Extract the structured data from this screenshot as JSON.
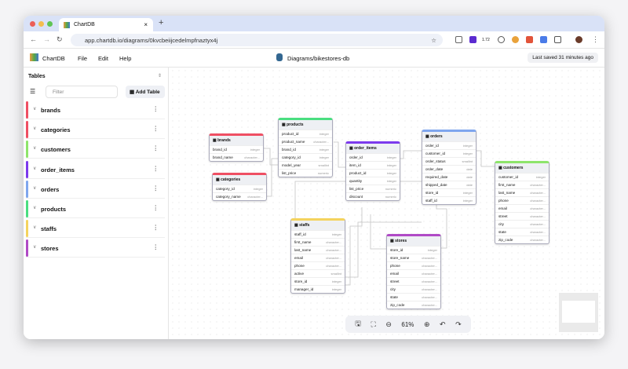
{
  "browser": {
    "tab_title": "ChartDB",
    "url": "app.chartdb.io/diagrams/0kvcbeiijcedelmpfnaztyx4j",
    "ext_badge": "1.72"
  },
  "app": {
    "logo": "ChartDB",
    "menu": [
      "File",
      "Edit",
      "Help"
    ],
    "diagram_title": "Diagrams/bikestores-db",
    "saved": "Last saved 31 minutes ago"
  },
  "sidebar": {
    "title": "Tables",
    "filter_placeholder": "Filter",
    "add_table": "Add Table",
    "items": [
      {
        "label": "brands",
        "color": "#ef4f63"
      },
      {
        "label": "categories",
        "color": "#ef4f63"
      },
      {
        "label": "customers",
        "color": "#8ee56b"
      },
      {
        "label": "order_items",
        "color": "#7c3aed"
      },
      {
        "label": "orders",
        "color": "#7fa6ee"
      },
      {
        "label": "products",
        "color": "#4ade80"
      },
      {
        "label": "staffs",
        "color": "#f4d35e"
      },
      {
        "label": "stores",
        "color": "#b04ac6"
      }
    ]
  },
  "tables": [
    {
      "name": "brands",
      "color": "#ef4f63",
      "rows": [
        [
          "brand_id",
          "integer"
        ],
        [
          "brand_name",
          "character..."
        ]
      ]
    },
    {
      "name": "categories",
      "color": "#ef4f63",
      "rows": [
        [
          "category_id",
          "integer"
        ],
        [
          "category_name",
          "character..."
        ]
      ]
    },
    {
      "name": "products",
      "color": "#4ade80",
      "rows": [
        [
          "product_id",
          "integer"
        ],
        [
          "product_name",
          "character..."
        ],
        [
          "brand_id",
          "integer"
        ],
        [
          "category_id",
          "integer"
        ],
        [
          "model_year",
          "smallint"
        ],
        [
          "list_price",
          "numeric"
        ]
      ]
    },
    {
      "name": "order_items",
      "color": "#7c3aed",
      "rows": [
        [
          "order_id",
          "integer"
        ],
        [
          "item_id",
          "integer"
        ],
        [
          "product_id",
          "integer"
        ],
        [
          "quantity",
          "integer"
        ],
        [
          "list_price",
          "numeric"
        ],
        [
          "discount",
          "numeric"
        ]
      ]
    },
    {
      "name": "orders",
      "color": "#7fa6ee",
      "rows": [
        [
          "order_id",
          "integer"
        ],
        [
          "customer_id",
          "integer"
        ],
        [
          "order_status",
          "smallint"
        ],
        [
          "order_date",
          "date"
        ],
        [
          "required_date",
          "date"
        ],
        [
          "shipped_date",
          "date"
        ],
        [
          "store_id",
          "integer"
        ],
        [
          "staff_id",
          "integer"
        ]
      ]
    },
    {
      "name": "customers",
      "color": "#8ee56b",
      "rows": [
        [
          "customer_id",
          "integer"
        ],
        [
          "first_name",
          "character..."
        ],
        [
          "last_name",
          "character..."
        ],
        [
          "phone",
          "character..."
        ],
        [
          "email",
          "character..."
        ],
        [
          "street",
          "character..."
        ],
        [
          "city",
          "character..."
        ],
        [
          "state",
          "character..."
        ],
        [
          "zip_code",
          "character..."
        ]
      ]
    },
    {
      "name": "staffs",
      "color": "#f4d35e",
      "rows": [
        [
          "staff_id",
          "integer"
        ],
        [
          "first_name",
          "character..."
        ],
        [
          "last_name",
          "character..."
        ],
        [
          "email",
          "character..."
        ],
        [
          "phone",
          "character..."
        ],
        [
          "active",
          "smallint"
        ],
        [
          "store_id",
          "integer"
        ],
        [
          "manager_id",
          "integer"
        ]
      ]
    },
    {
      "name": "stores",
      "color": "#b04ac6",
      "rows": [
        [
          "store_id",
          "integer"
        ],
        [
          "store_name",
          "character..."
        ],
        [
          "phone",
          "character..."
        ],
        [
          "email",
          "character..."
        ],
        [
          "street",
          "character..."
        ],
        [
          "city",
          "character..."
        ],
        [
          "state",
          "character..."
        ],
        [
          "zip_code",
          "character..."
        ]
      ]
    }
  ],
  "toolbar": {
    "zoom": "61%"
  }
}
